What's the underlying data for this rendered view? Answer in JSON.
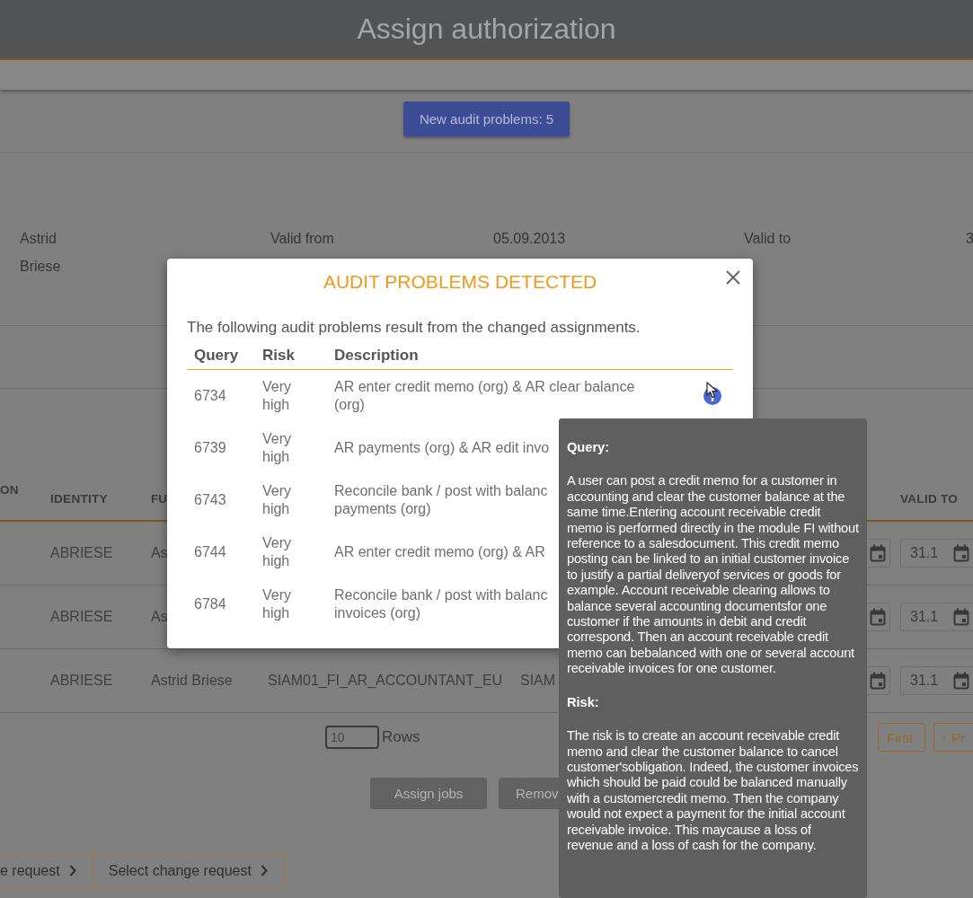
{
  "header": {
    "title": "Assign authorization"
  },
  "audit_button": {
    "label": "New audit problems: 5"
  },
  "person": {
    "first_name": "Astrid",
    "last_name": "Briese"
  },
  "validity": [
    {
      "label": "Valid from",
      "value": "05.09.2013"
    },
    {
      "label": "Valid to",
      "value": "3"
    }
  ],
  "table": {
    "columns": [
      {
        "label": "ON"
      },
      {
        "label": "IDENTITY"
      },
      {
        "label": "FU"
      },
      {
        "label": "VALID TO"
      }
    ],
    "rows": [
      {
        "cells": [
          "",
          "ABRIESE",
          "As"
        ],
        "valid_to": "31.1"
      },
      {
        "cells": [
          "",
          "ABRIESE",
          "As"
        ],
        "valid_to": "31.1"
      },
      {
        "cells": [
          "",
          "ABRIESE",
          "Astrid Briese",
          "SIAM01_FI_AR_ACCOUNTANT_EU",
          "SIAM"
        ],
        "valid_to": "31.1"
      }
    ]
  },
  "pagination": {
    "rows_per_page": "10",
    "rows_label": "Rows",
    "buttons": [
      {
        "label": "First",
        "kind": "plain"
      },
      {
        "label": "Pr",
        "kind": "previous"
      }
    ]
  },
  "actions": [
    {
      "label": "Assign jobs",
      "disabled": true
    },
    {
      "label": "Remov",
      "disabled": true
    }
  ],
  "bottom_buttons": [
    {
      "label": "e request"
    },
    {
      "label": "Select change request"
    }
  ],
  "dialog": {
    "title": "AUDIT PROBLEMS DETECTED",
    "intro": "The following audit problems result from the changed assignments.",
    "columns": [
      "Query",
      "Risk",
      "Description"
    ],
    "rows": [
      {
        "query": "6734",
        "risk": "Very high",
        "description_lines": [
          "AR enter credit memo (org) & AR clear balance",
          "(org)"
        ],
        "info_hovered": true
      },
      {
        "query": "6739",
        "risk": "Very high",
        "description_lines": [
          "AR payments (org) & AR edit invo"
        ]
      },
      {
        "query": "6743",
        "risk": "Very high",
        "description_lines": [
          "Reconcile bank / post with balanc",
          "payments (org)"
        ]
      },
      {
        "query": "6744",
        "risk": "Very high",
        "description_lines": [
          "AR enter credit memo (org) & AR"
        ]
      },
      {
        "query": "6784",
        "risk": "Very high",
        "description_lines": [
          "Reconcile bank / post with balanc",
          "invoices (org)"
        ]
      }
    ]
  },
  "tooltip": {
    "sections": [
      {
        "heading": "Query:",
        "text": "A user can post a credit memo for a customer in accounting and clear the customer balance at the same time.Entering account receivable credit memo is performed directly in the module FI without reference to a salesdocument. This credit memo posting can be linked to an initial customer invoice to justify a partial deliveryof services or goods for example. Account receivable clearing allows to balance several accounting documentsfor one customer if the amounts in debit and credit correspond. Then an account receivable credit memo can bebalanced with one or several account receivable invoices for one customer."
      },
      {
        "heading": "Risk:",
        "text": "The risk is to create an account receivable credit memo and clear the customer balance to cancel customer'sobligation. Indeed, the customer invoices which should be paid could be balanced manually with a customercredit memo. Then the company would not expect a payment for the initial account receivable invoice. This maycause a loss of revenue and a loss of cash for the company."
      }
    ]
  }
}
